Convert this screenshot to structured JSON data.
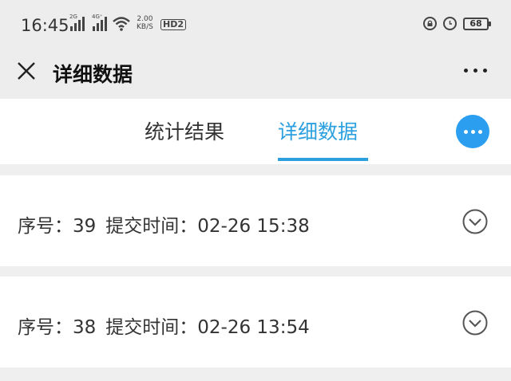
{
  "status_bar": {
    "time": "16:45",
    "net1": "2G",
    "net2": "4G⁺",
    "speed_value": "2.00",
    "speed_unit": "KB/S",
    "hd_label": "HD2",
    "battery": "68"
  },
  "header": {
    "title": "详细数据",
    "close_icon": "close-icon",
    "menu_icon": "more-dots-icon"
  },
  "tabs": [
    {
      "label": "统计结果",
      "active": false
    },
    {
      "label": "详细数据",
      "active": true
    }
  ],
  "accent_color": "#2ca0df",
  "records": [
    {
      "seq_label": "序号：",
      "seq": "39",
      "time_label": "提交时间：",
      "time": "02-26 15:38"
    },
    {
      "seq_label": "序号：",
      "seq": "38",
      "time_label": "提交时间：",
      "time": "02-26 13:54"
    }
  ]
}
